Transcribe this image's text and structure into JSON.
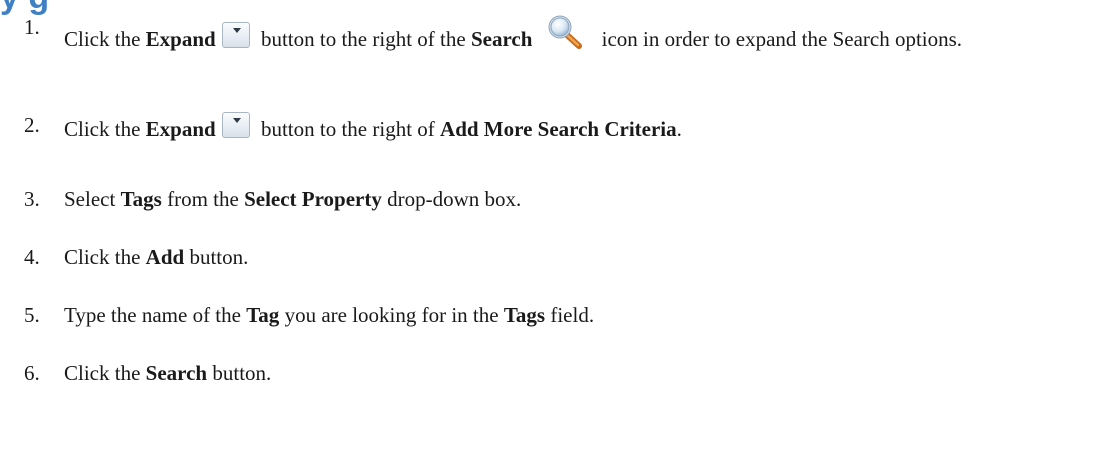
{
  "heading_fragment": "y g",
  "icons": {
    "expand": "expand-dropdown-icon",
    "search": "magnifier-search-icon"
  },
  "steps": [
    {
      "number": "1.",
      "t1": "Click the ",
      "b1": "Expand",
      "t2": " button to the right of the ",
      "b2": "Search",
      "t3": " icon in order to expand the Search options."
    },
    {
      "number": "2.",
      "t1": "Click the ",
      "b1": "Expand",
      "t2": " button to the right of ",
      "b2": "Add More Search Criteria",
      "t3": "."
    },
    {
      "number": "3.",
      "t1": "Select ",
      "b1": "Tags",
      "t2": " from the ",
      "b2": "Select Property",
      "t3": " drop-down box."
    },
    {
      "number": "4.",
      "t1": "Click the ",
      "b1": "Add",
      "t2": " button."
    },
    {
      "number": "5.",
      "t1": "Type the name of the ",
      "b1": "Tag",
      "t2": " you are looking for in the ",
      "b2": "Tags",
      "t3": " field."
    },
    {
      "number": "6.",
      "t1": "Click the ",
      "b1": "Search",
      "t2": " button."
    }
  ]
}
